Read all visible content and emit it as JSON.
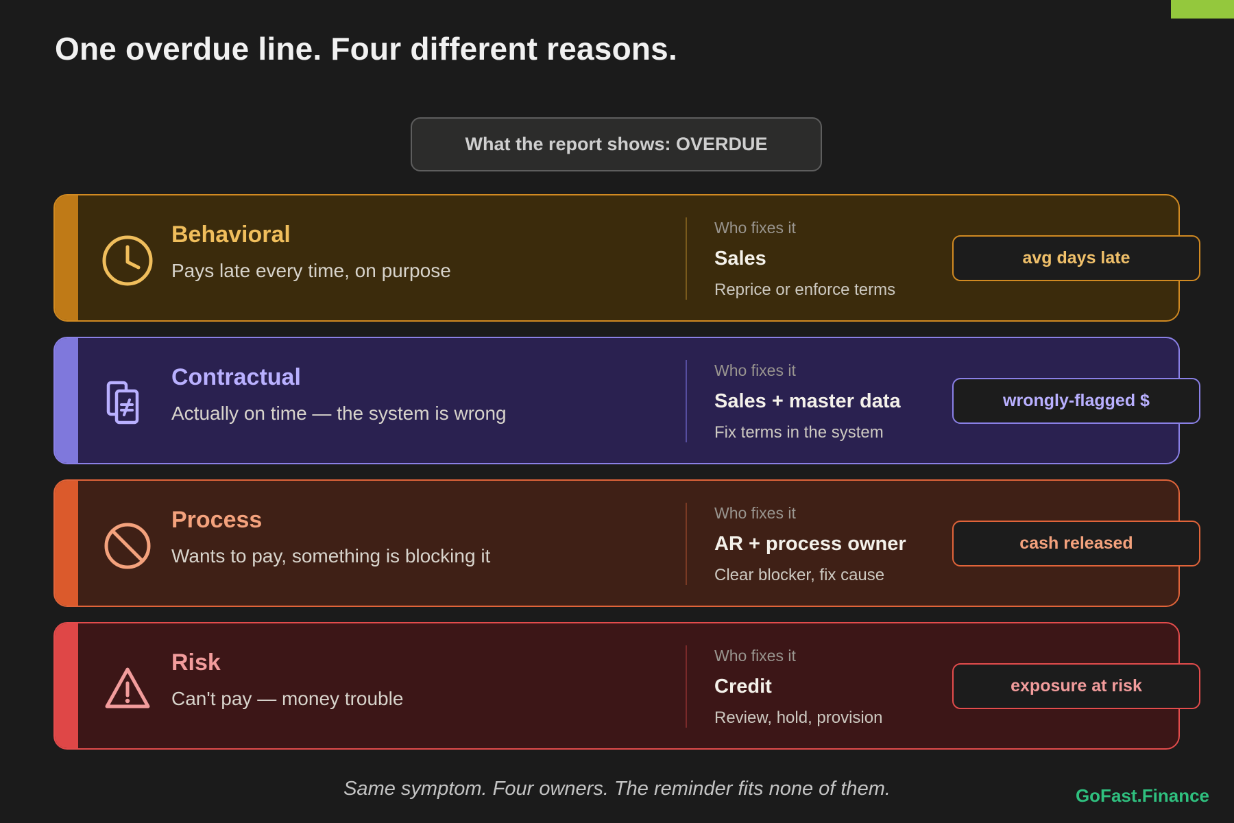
{
  "title": "One overdue line. Four different reasons.",
  "report_label": "What the report shows: OVERDUE",
  "categories": [
    {
      "name": "Behavioral",
      "description": "Pays late every time, on purpose",
      "who_label": "Who fixes it",
      "owner": "Sales",
      "action": "Reprice or enforce terms",
      "metric": "avg days late",
      "icon": "clock-icon",
      "accent_color": "#d18a22"
    },
    {
      "name": "Contractual",
      "description": "Actually on time — the system is wrong",
      "who_label": "Who fixes it",
      "owner": "Sales + master data",
      "action": "Fix terms in the system",
      "metric": "wrongly-flagged $",
      "icon": "mismatch-documents-icon",
      "accent_color": "#8a80e6"
    },
    {
      "name": "Process",
      "description": "Wants to pay, something is blocking it",
      "who_label": "Who fixes it",
      "owner": "AR + process owner",
      "action": "Clear blocker, fix cause",
      "metric": "cash released",
      "icon": "blocked-icon",
      "accent_color": "#e0643a"
    },
    {
      "name": "Risk",
      "description": "Can't pay — money trouble",
      "who_label": "Who fixes it",
      "owner": "Credit",
      "action": "Review, hold, provision",
      "metric": "exposure at risk",
      "icon": "warning-icon",
      "accent_color": "#e34c4c"
    }
  ],
  "footer": "Same symptom. Four owners. The reminder fits none of them.",
  "brand": "GoFast.Finance",
  "colors": {
    "background": "#1b1b1b",
    "corner_accent": "#94c83d",
    "brand": "#2fc07f"
  }
}
